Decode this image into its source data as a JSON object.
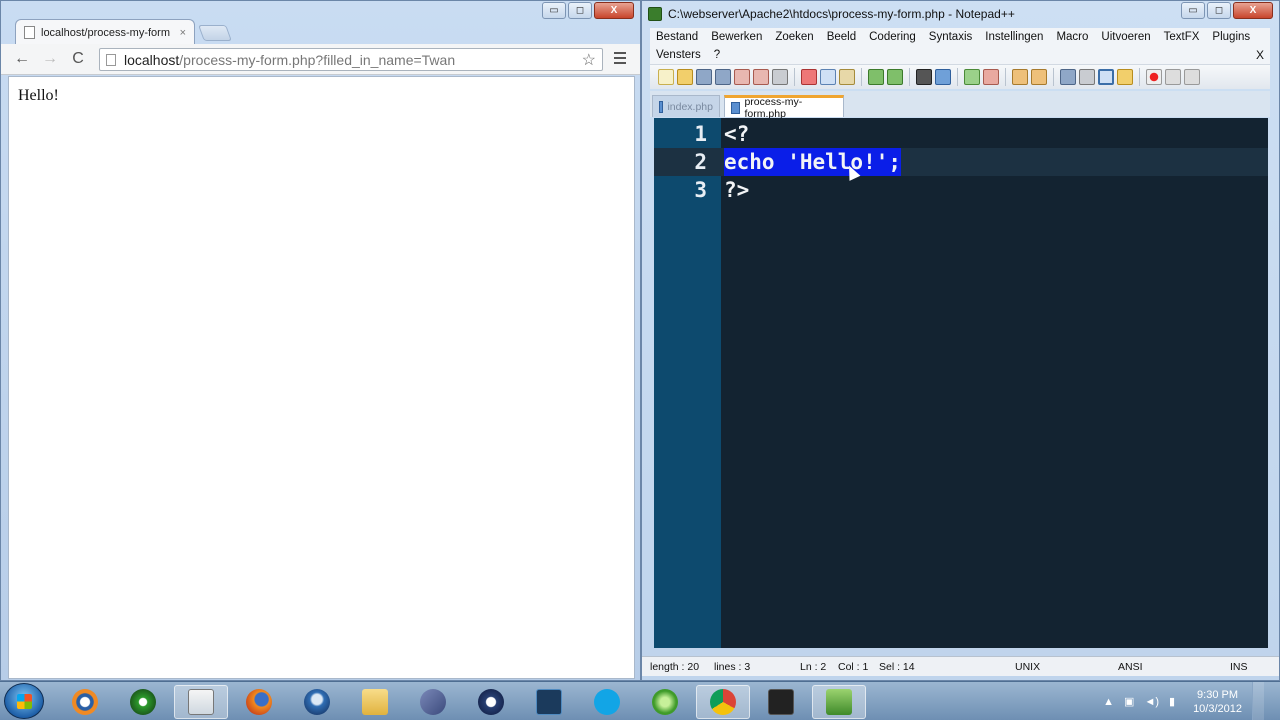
{
  "browser": {
    "tab_title": "localhost/process-my-form",
    "tab_close": "×",
    "url_host": "localhost",
    "url_path": "/process-my-form.php?filled_in_name=Twan",
    "page_output": "Hello!",
    "nav_back": "←",
    "nav_forward": "→",
    "nav_reload": "C",
    "star": "☆"
  },
  "notepadpp": {
    "title": "C:\\webserver\\Apache2\\htdocs\\process-my-form.php - Notepad++",
    "menu_row1": [
      "Bestand",
      "Bewerken",
      "Zoeken",
      "Beeld",
      "Codering",
      "Syntaxis",
      "Instellingen",
      "Macro",
      "Uitvoeren",
      "TextFX",
      "Plugins"
    ],
    "menu_row2": [
      "Vensters",
      "?"
    ],
    "menu_close": "X",
    "tabs": [
      {
        "label": "index.php",
        "active": false
      },
      {
        "label": "process-my-form.php",
        "active": true
      }
    ],
    "lines": [
      {
        "num": "1",
        "code": "<?"
      },
      {
        "num": "2",
        "code": "echo 'Hello!';"
      },
      {
        "num": "3",
        "code": "?>"
      }
    ],
    "status": {
      "length": "length : 20",
      "lines": "lines : 3",
      "ln": "Ln : 2",
      "col": "Col : 1",
      "sel": "Sel : 14",
      "eol": "UNIX",
      "encoding": "ANSI",
      "mode": "INS"
    },
    "colors": {
      "editor_bg": "#132331",
      "gutter_bg": "#0d4a6e",
      "selection_bg": "#0a1ee8",
      "selection_fg": "#e8c766"
    }
  },
  "window_controls": {
    "minimize": "▭",
    "maximize": "◻",
    "close": "X"
  },
  "taskbar": {
    "apps": [
      "blender-icon",
      "media-player-icon",
      "task-manager-icon",
      "firefox-icon",
      "thunderbird-icon",
      "folder-icon",
      "dolphin-icon",
      "keepass-icon",
      "photoshop-icon",
      "skype-icon",
      "sidebar-app-icon",
      "chrome-icon",
      "brackets-icon",
      "notepadpp-icon"
    ],
    "time": "9:30 PM",
    "date": "10/3/2012"
  }
}
